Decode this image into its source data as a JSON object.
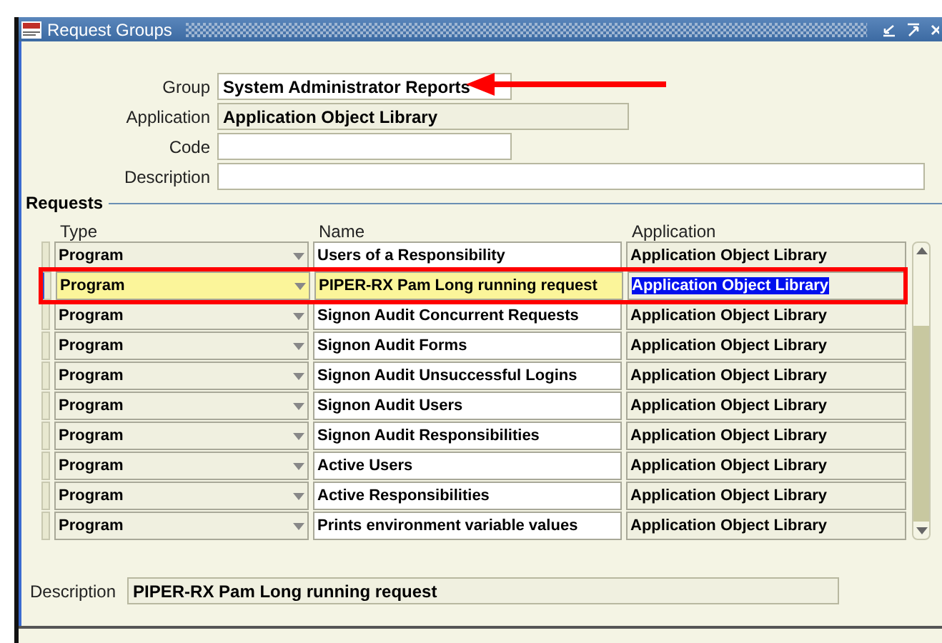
{
  "window": {
    "title": "Request Groups"
  },
  "header_fields": [
    {
      "label": "Group",
      "value": "System Administrator Reports",
      "kind": "short"
    },
    {
      "label": "Application",
      "value": "Application Object Library",
      "kind": "readonly"
    },
    {
      "label": "Code",
      "kind": "short"
    },
    {
      "label": "Description",
      "kind": "long"
    }
  ],
  "requests": {
    "title": "Requests",
    "columns": [
      "Type",
      "Name",
      "Application"
    ],
    "rows": [
      {
        "type": "Program",
        "name": "Users of a Responsibility",
        "application": "Application Object Library",
        "selected": false
      },
      {
        "type": "Program",
        "name": "PIPER-RX Pam Long running request",
        "application": "Application Object Library",
        "selected": true
      },
      {
        "type": "Program",
        "name": "Signon Audit Concurrent Requests",
        "application": "Application Object Library",
        "selected": false
      },
      {
        "type": "Program",
        "name": "Signon Audit Forms",
        "application": "Application Object Library",
        "selected": false
      },
      {
        "type": "Program",
        "name": "Signon Audit Unsuccessful Logins",
        "application": "Application Object Library",
        "selected": false
      },
      {
        "type": "Program",
        "name": "Signon Audit Users",
        "application": "Application Object Library",
        "selected": false
      },
      {
        "type": "Program",
        "name": "Signon Audit Responsibilities",
        "application": "Application Object Library",
        "selected": false
      },
      {
        "type": "Program",
        "name": "Active Users",
        "application": "Application Object Library",
        "selected": false
      },
      {
        "type": "Program",
        "name": "Active Responsibilities",
        "application": "Application Object Library",
        "selected": false
      },
      {
        "type": "Program",
        "name": "Prints environment variable values",
        "application": "Application Object Library",
        "selected": false
      }
    ]
  },
  "description": {
    "label": "Description",
    "value": "PIPER-RX Pam Long running request"
  }
}
